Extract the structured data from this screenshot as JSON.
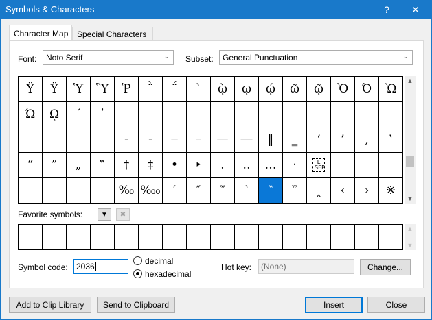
{
  "window": {
    "title": "Symbols & Characters",
    "help_glyph": "?",
    "close_glyph": "✕",
    "accent_color": "#1979ca"
  },
  "tabs": [
    {
      "label": "Character Map",
      "active": true
    },
    {
      "label": "Special Characters",
      "active": false
    }
  ],
  "font": {
    "label": "Font:",
    "value": "Noto Serif"
  },
  "subset": {
    "label": "Subset:",
    "value": "General Punctuation"
  },
  "char_grid": {
    "rows": [
      [
        "Ϋ",
        "Ϋ",
        "Ὑ",
        "Ὓ",
        "Ῥ",
        "῭",
        "΅",
        "`",
        "ῲ",
        "ῳ",
        "ῴ",
        "ῶ",
        "ῷ",
        "Ὸ",
        "Ό",
        "Ὼ"
      ],
      [
        "Ώ",
        "ῼ",
        "´",
        "῾",
        "",
        "",
        "",
        "",
        "",
        "",
        "",
        "",
        "",
        "",
        "",
        ""
      ],
      [
        "",
        "",
        "",
        "",
        "‐",
        "‑",
        "‒",
        "–",
        "—",
        "―",
        "‖",
        "‗",
        "‘",
        "’",
        "‚",
        "‛"
      ],
      [
        "“",
        "”",
        "„",
        "‟",
        "†",
        "‡",
        "•",
        "‣",
        "․",
        "‥",
        "…",
        "‧",
        "LSEP",
        "",
        "",
        ""
      ],
      [
        "",
        "",
        "",
        "",
        "‰",
        "‱",
        "′",
        "″",
        "‴",
        "‵",
        "‶",
        "‷",
        "‸",
        "‹",
        "›",
        "※"
      ]
    ],
    "selected": {
      "row": 4,
      "col": 10
    }
  },
  "favorites": {
    "label": "Favorite symbols:",
    "count": 16
  },
  "symbol_code": {
    "label": "Symbol code:",
    "value": "2036"
  },
  "radios": [
    {
      "label": "decimal",
      "checked": false
    },
    {
      "label": "hexadecimal",
      "checked": true
    }
  ],
  "hotkey": {
    "label": "Hot key:",
    "value": "(None)"
  },
  "buttons": {
    "change": "Change...",
    "add_clip": "Add to Clip Library",
    "send_clip": "Send to Clipboard",
    "insert": "Insert",
    "close": "Close"
  }
}
